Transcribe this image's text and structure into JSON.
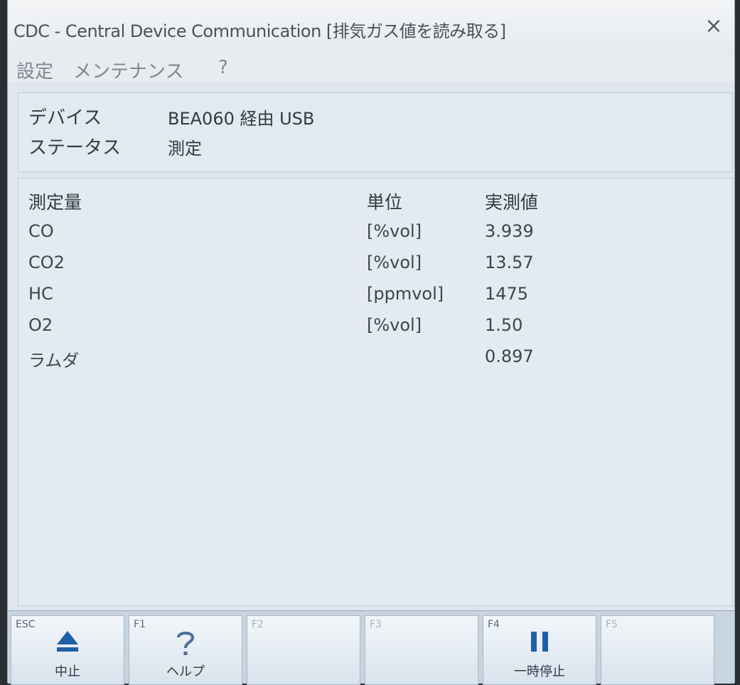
{
  "window": {
    "title": "CDC - Central Device Communication [排気ガス値を読み取る]",
    "close_symbol": "×"
  },
  "menu": {
    "items": [
      "設定",
      "メンテナンス",
      "?"
    ]
  },
  "device": {
    "device_label": "デバイス",
    "device_value": "BEA060 経由 USB",
    "status_label": "ステータス",
    "status_value": "測定"
  },
  "table": {
    "headers": {
      "quantity": "測定量",
      "unit": "単位",
      "value": "実測値"
    },
    "rows": [
      {
        "quantity": "CO",
        "unit": "[%vol]",
        "value": "3.939"
      },
      {
        "quantity": "CO2",
        "unit": "[%vol]",
        "value": "13.57"
      },
      {
        "quantity": "HC",
        "unit": "[ppmvol]",
        "value": "1475"
      },
      {
        "quantity": "O2",
        "unit": "[%vol]",
        "value": "1.50"
      },
      {
        "quantity": "ラムダ",
        "unit": "",
        "value": "0.897"
      }
    ]
  },
  "fkeys": [
    {
      "key": "ESC",
      "label": "中止",
      "icon": "eject-icon",
      "enabled": true
    },
    {
      "key": "F1",
      "label": "ヘルプ",
      "icon": "question-icon",
      "enabled": true
    },
    {
      "key": "F2",
      "label": "",
      "icon": "",
      "enabled": false
    },
    {
      "key": "F3",
      "label": "",
      "icon": "",
      "enabled": false
    },
    {
      "key": "F4",
      "label": "一時停止",
      "icon": "pause-icon",
      "enabled": true
    },
    {
      "key": "F5",
      "label": "",
      "icon": "",
      "enabled": false
    }
  ],
  "colors": {
    "window_bg": "#dfe6ee",
    "panel_bg": "#e4eaf1",
    "icon_blue": "#1e5fa8"
  }
}
